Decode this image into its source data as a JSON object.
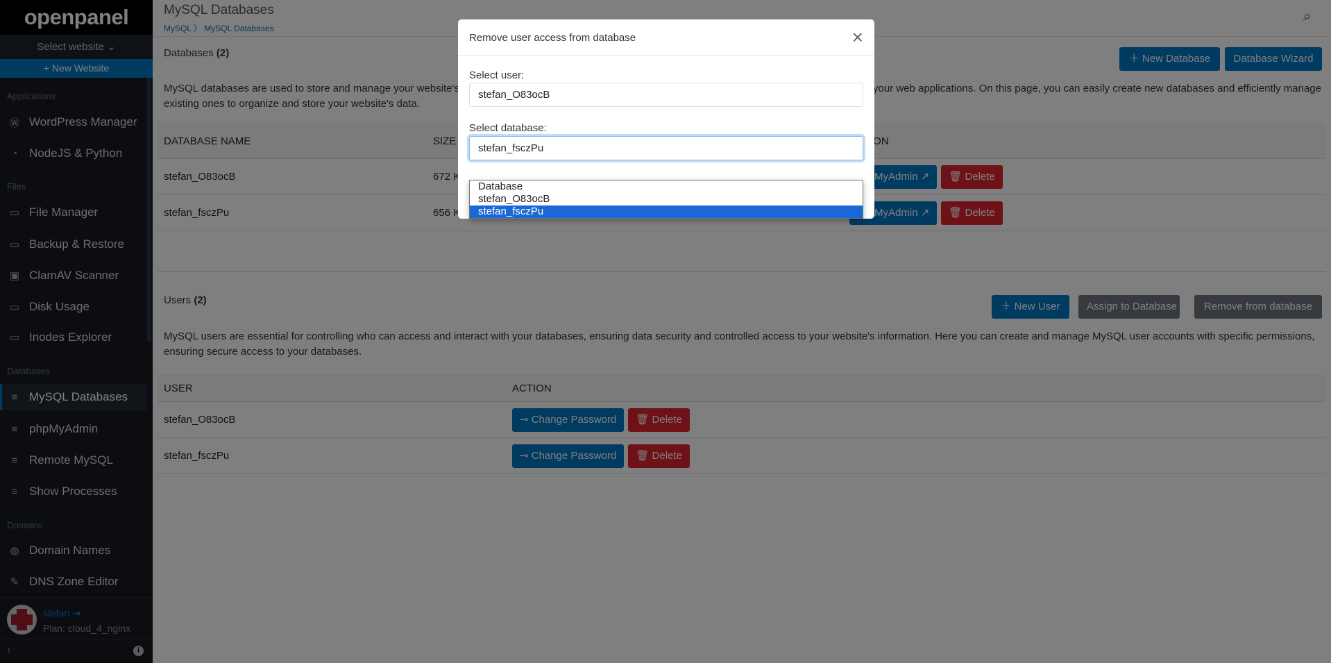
{
  "sidebar": {
    "logo": "openpanel",
    "select_website": "Select website",
    "new_website": "+ New Website",
    "sections": {
      "applications": "Applications",
      "files": "Files",
      "databases": "Databases",
      "domains": "Domains"
    },
    "items": [
      {
        "label": "WordPress Manager",
        "icon": "wordpress-icon"
      },
      {
        "label": "NodeJS & Python",
        "icon": "nodejs-icon"
      },
      {
        "label": "File Manager",
        "icon": "folder-icon"
      },
      {
        "label": "Backup & Restore",
        "icon": "folder-icon"
      },
      {
        "label": "ClamAV Scanner",
        "icon": "scanner-icon"
      },
      {
        "label": "Disk Usage",
        "icon": "folder-icon"
      },
      {
        "label": "Inodes Explorer",
        "icon": "folder-icon"
      },
      {
        "label": "MySQL Databases",
        "icon": "database-icon",
        "active": true
      },
      {
        "label": "phpMyAdmin",
        "icon": "database-icon"
      },
      {
        "label": "Remote MySQL",
        "icon": "database-icon"
      },
      {
        "label": "Show Processes",
        "icon": "database-icon"
      },
      {
        "label": "Domain Names",
        "icon": "globe-icon"
      },
      {
        "label": "DNS Zone Editor",
        "icon": "edit-icon"
      }
    ],
    "user": {
      "name": "stefan",
      "plan": "Plan: cloud_4_nginx"
    }
  },
  "header": {
    "title": "MySQL Databases",
    "breadcrumb": [
      "MySQL",
      "MySQL Databases"
    ]
  },
  "databases": {
    "title": "Databases",
    "count": "(2)",
    "new_button": "New Database",
    "wizard_button": "Database Wizard",
    "description": "MySQL databases are used to store and manage your website's data, such as user information, content, and settings, in a structured format optimized for your web applications. On this page, you can easily create new databases and efficiently manage existing ones to organize and store your website's data.",
    "columns": [
      "DATABASE NAME",
      "SIZE",
      "ACTION"
    ],
    "rows": [
      {
        "name": "stefan_O83ocB",
        "size": "672 KB"
      },
      {
        "name": "stefan_fsczPu",
        "size": "656 KB"
      }
    ],
    "phpmyadmin_label": "phpMyAdmin",
    "delete_label": "Delete"
  },
  "users": {
    "title": "Users",
    "count": "(2)",
    "new_button": "New  User",
    "assign_button": "Assign  to Database",
    "remove_button": "Remove  from database",
    "description": "MySQL users are essential for controlling who can access and interact with your databases, ensuring data security and controlled access to your website's information. Here you can create and manage MySQL user accounts with specific permissions, ensuring secure access to your databases.",
    "columns": [
      "USER",
      "ACTION"
    ],
    "rows": [
      {
        "name": "stefan_O83ocB"
      },
      {
        "name": "stefan_fsczPu"
      }
    ],
    "change_password_label": "Change Password",
    "delete_label": "Delete"
  },
  "modal": {
    "title": "Remove user access from database",
    "user_label": "Select user:",
    "user_value": "stefan_O83ocB",
    "db_label": "Select database:",
    "db_value": "stefan_fsczPu",
    "options": [
      "Database",
      "stefan_O83ocB",
      "stefan_fsczPu"
    ],
    "selected_index": 2
  }
}
